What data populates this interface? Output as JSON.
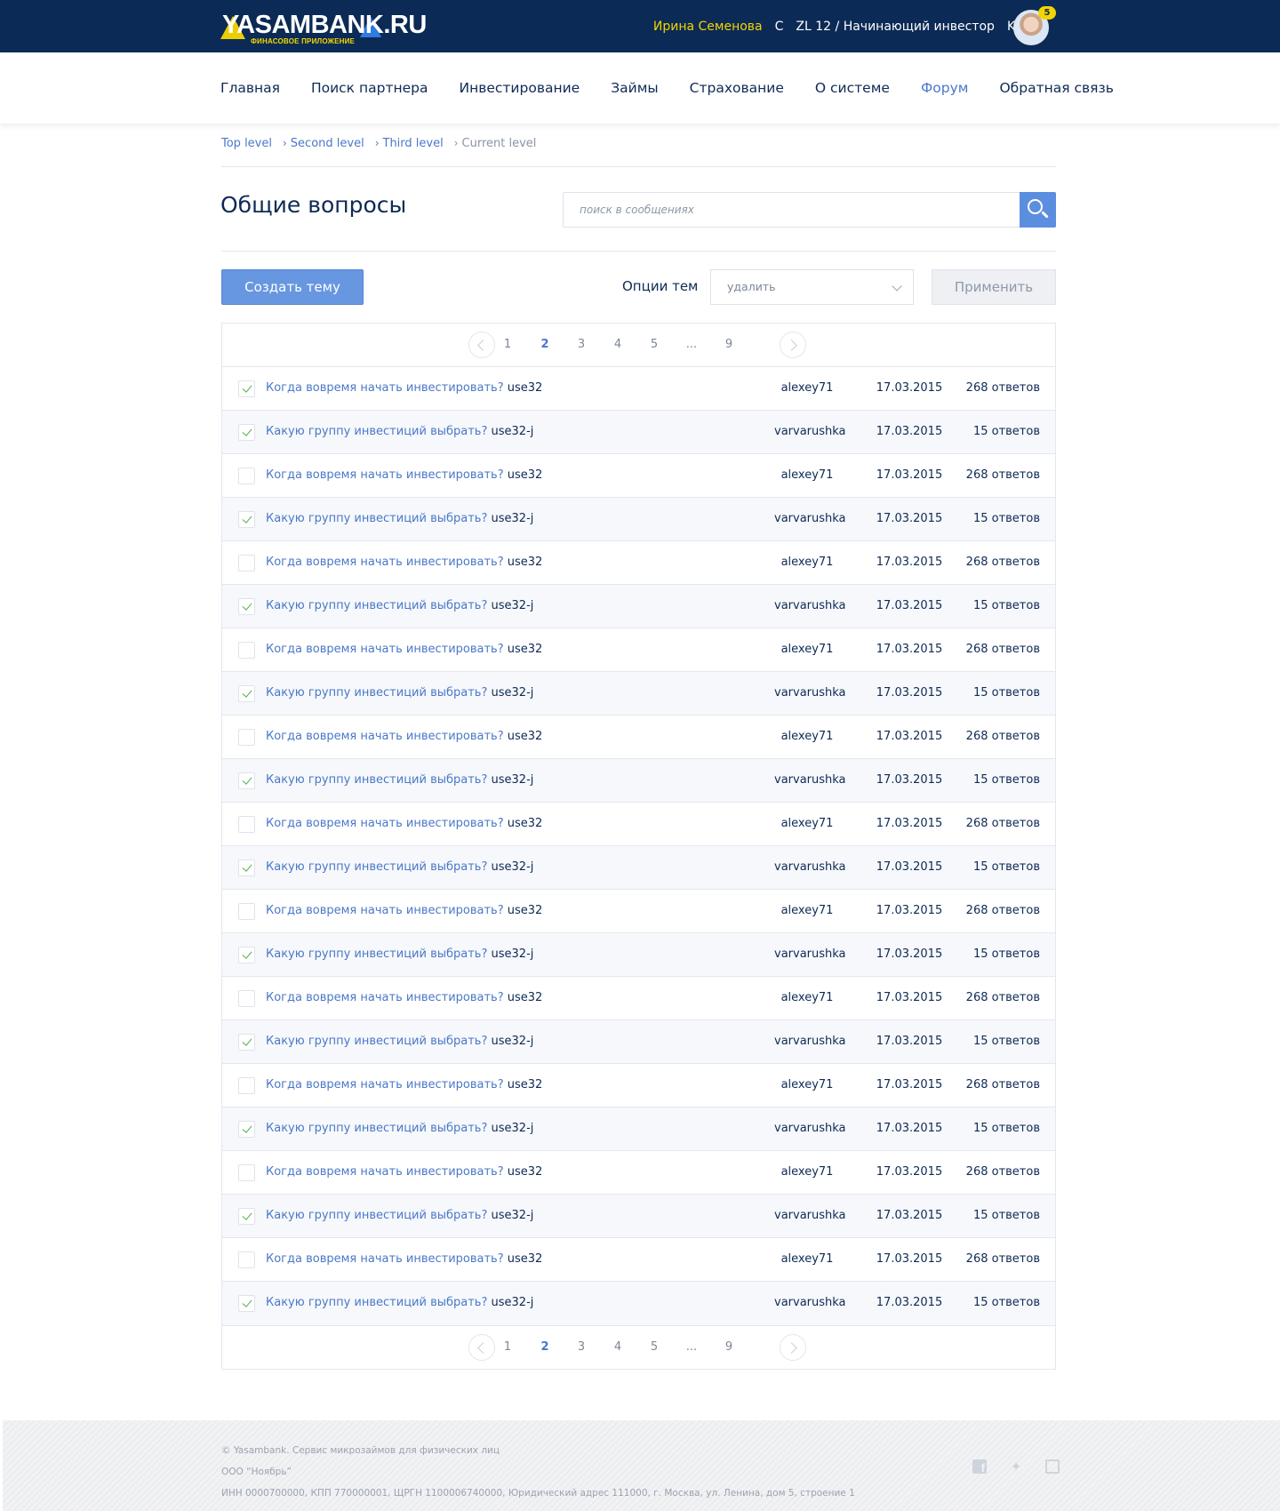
{
  "header": {
    "logo_text": "YASAMBANK.RU",
    "logo_subtitle": "ФИНАСОВОЕ ПРИЛОЖЕНИЕ",
    "user_name": "Ирина Семенова",
    "currency": "C",
    "level": "ZL 12 / Начинающий инвестор",
    "kz": "KZ 23",
    "notifications": "5"
  },
  "nav": {
    "items": [
      {
        "label": "Главная",
        "active": false
      },
      {
        "label": "Поиск партнера",
        "active": false
      },
      {
        "label": "Инвестирование",
        "active": false
      },
      {
        "label": "Займы",
        "active": false
      },
      {
        "label": "Страхование",
        "active": false
      },
      {
        "label": "О системе",
        "active": false
      },
      {
        "label": "Форум",
        "active": true
      },
      {
        "label": "Обратная связь",
        "active": false
      }
    ]
  },
  "breadcrumb": {
    "items": [
      "Top level",
      "Second level",
      "Third level"
    ],
    "current": "Current level"
  },
  "page": {
    "title": "Общие вопросы",
    "search_placeholder": "поиск в сообщениях"
  },
  "toolbar": {
    "create_label": "Создать тему",
    "options_label": "Опции тем",
    "select_value": "удалить",
    "apply_label": "Применить"
  },
  "pagination": {
    "pages": [
      "1",
      "2",
      "3",
      "4",
      "5",
      "...",
      "9"
    ],
    "current": "2"
  },
  "topics": [
    {
      "title": "Когда вовремя начать инвестировать?",
      "tag": "use32",
      "author": "alexey71",
      "date": "17.03.2015",
      "replies": "268 ответов",
      "checked": true
    },
    {
      "title": "Какую группу инвестиций выбрать?",
      "tag": "use32-j",
      "author": "varvarushka",
      "date": "17.03.2015",
      "replies": "15 ответов",
      "checked": true
    },
    {
      "title": "Когда вовремя начать инвестировать?",
      "tag": "use32",
      "author": "alexey71",
      "date": "17.03.2015",
      "replies": "268 ответов",
      "checked": false
    },
    {
      "title": "Какую группу инвестиций выбрать?",
      "tag": "use32-j",
      "author": "varvarushka",
      "date": "17.03.2015",
      "replies": "15 ответов",
      "checked": true
    },
    {
      "title": "Когда вовремя начать инвестировать?",
      "tag": "use32",
      "author": "alexey71",
      "date": "17.03.2015",
      "replies": "268 ответов",
      "checked": false
    },
    {
      "title": "Какую группу инвестиций выбрать?",
      "tag": "use32-j",
      "author": "varvarushka",
      "date": "17.03.2015",
      "replies": "15 ответов",
      "checked": true
    },
    {
      "title": "Когда вовремя начать инвестировать?",
      "tag": "use32",
      "author": "alexey71",
      "date": "17.03.2015",
      "replies": "268 ответов",
      "checked": false
    },
    {
      "title": "Какую группу инвестиций выбрать?",
      "tag": "use32-j",
      "author": "varvarushka",
      "date": "17.03.2015",
      "replies": "15 ответов",
      "checked": true
    },
    {
      "title": "Когда вовремя начать инвестировать?",
      "tag": "use32",
      "author": "alexey71",
      "date": "17.03.2015",
      "replies": "268 ответов",
      "checked": false
    },
    {
      "title": "Какую группу инвестиций выбрать?",
      "tag": "use32-j",
      "author": "varvarushka",
      "date": "17.03.2015",
      "replies": "15 ответов",
      "checked": true
    },
    {
      "title": "Когда вовремя начать инвестировать?",
      "tag": "use32",
      "author": "alexey71",
      "date": "17.03.2015",
      "replies": "268 ответов",
      "checked": false
    },
    {
      "title": "Какую группу инвестиций выбрать?",
      "tag": "use32-j",
      "author": "varvarushka",
      "date": "17.03.2015",
      "replies": "15 ответов",
      "checked": true
    },
    {
      "title": "Когда вовремя начать инвестировать?",
      "tag": "use32",
      "author": "alexey71",
      "date": "17.03.2015",
      "replies": "268 ответов",
      "checked": false
    },
    {
      "title": "Какую группу инвестиций выбрать?",
      "tag": "use32-j",
      "author": "varvarushka",
      "date": "17.03.2015",
      "replies": "15 ответов",
      "checked": true
    },
    {
      "title": "Когда вовремя начать инвестировать?",
      "tag": "use32",
      "author": "alexey71",
      "date": "17.03.2015",
      "replies": "268 ответов",
      "checked": false
    },
    {
      "title": "Какую группу инвестиций выбрать?",
      "tag": "use32-j",
      "author": "varvarushka",
      "date": "17.03.2015",
      "replies": "15 ответов",
      "checked": true
    },
    {
      "title": "Когда вовремя начать инвестировать?",
      "tag": "use32",
      "author": "alexey71",
      "date": "17.03.2015",
      "replies": "268 ответов",
      "checked": false
    },
    {
      "title": "Какую группу инвестиций выбрать?",
      "tag": "use32-j",
      "author": "varvarushka",
      "date": "17.03.2015",
      "replies": "15 ответов",
      "checked": true
    },
    {
      "title": "Когда вовремя начать инвестировать?",
      "tag": "use32",
      "author": "alexey71",
      "date": "17.03.2015",
      "replies": "268 ответов",
      "checked": false
    },
    {
      "title": "Какую группу инвестиций выбрать?",
      "tag": "use32-j",
      "author": "varvarushka",
      "date": "17.03.2015",
      "replies": "15 ответов",
      "checked": true
    },
    {
      "title": "Когда вовремя начать инвестировать?",
      "tag": "use32",
      "author": "alexey71",
      "date": "17.03.2015",
      "replies": "268 ответов",
      "checked": false
    },
    {
      "title": "Какую группу инвестиций выбрать?",
      "tag": "use32-j",
      "author": "varvarushka",
      "date": "17.03.2015",
      "replies": "15 ответов",
      "checked": true
    }
  ],
  "footer": {
    "line1": "© Yasambank. Сервис микрозаймов для физических лиц",
    "line2": "ООО “Ноябрь”",
    "line3": "ИНН 0000700000, КПП 770000001, ЩРГН 1100006740000, Юридический адрес 111000, г. Москва, ул. Ленина, дом 5, строение 1",
    "social": [
      "facebook-icon",
      "twitter-icon",
      "instagram-icon"
    ]
  },
  "colors": {
    "header_bg": "#0b2a55",
    "accent": "#4a78c8",
    "user_name": "#f3d400",
    "button": "#6797e0",
    "check": "#4cae4c"
  }
}
